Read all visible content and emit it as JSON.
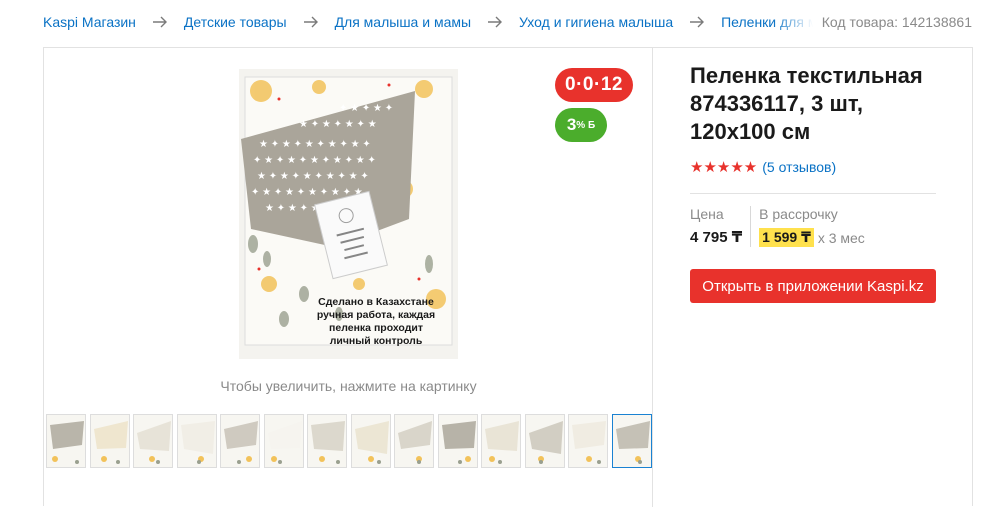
{
  "breadcrumbs": [
    {
      "label": "Kaspi Магазин"
    },
    {
      "label": "Детские товары"
    },
    {
      "label": "Для малыша и мамы"
    },
    {
      "label": "Уход и гигиена малыша"
    },
    {
      "label": "Пеленки для малышей"
    }
  ],
  "product_code": "Код товара: 142138861",
  "badges": {
    "installment": "0·0·12",
    "bonus_value": "3",
    "bonus_suffix": "% Б"
  },
  "main_image": {
    "caption_lines": [
      "Сделано в Казахстане",
      "ручная работа, каждая",
      "пеленка проходит",
      "личный контроль"
    ]
  },
  "zoom_hint": "Чтобы увеличить, нажмите на картинку",
  "thumbnails": {
    "count": 14,
    "active_index": 13
  },
  "product": {
    "title": "Пеленка текстильная 874336117, 3 шт, 120x100 см",
    "rating_stars": "★★★★★",
    "rating": 5,
    "reviews": "(5 отзывов)"
  },
  "price": {
    "label": "Цена",
    "value": "4 795 ₸"
  },
  "installment": {
    "label": "В рассрочку",
    "monthly": "1 599 ₸",
    "term": "x 3 мес"
  },
  "buy_button": "Открыть в приложении Kaspi.kz",
  "colors": {
    "accent_red": "#e8322c",
    "bonus_green": "#4bad2c",
    "link_blue": "#0a72c5",
    "highlight_yellow": "#ffe14d"
  }
}
